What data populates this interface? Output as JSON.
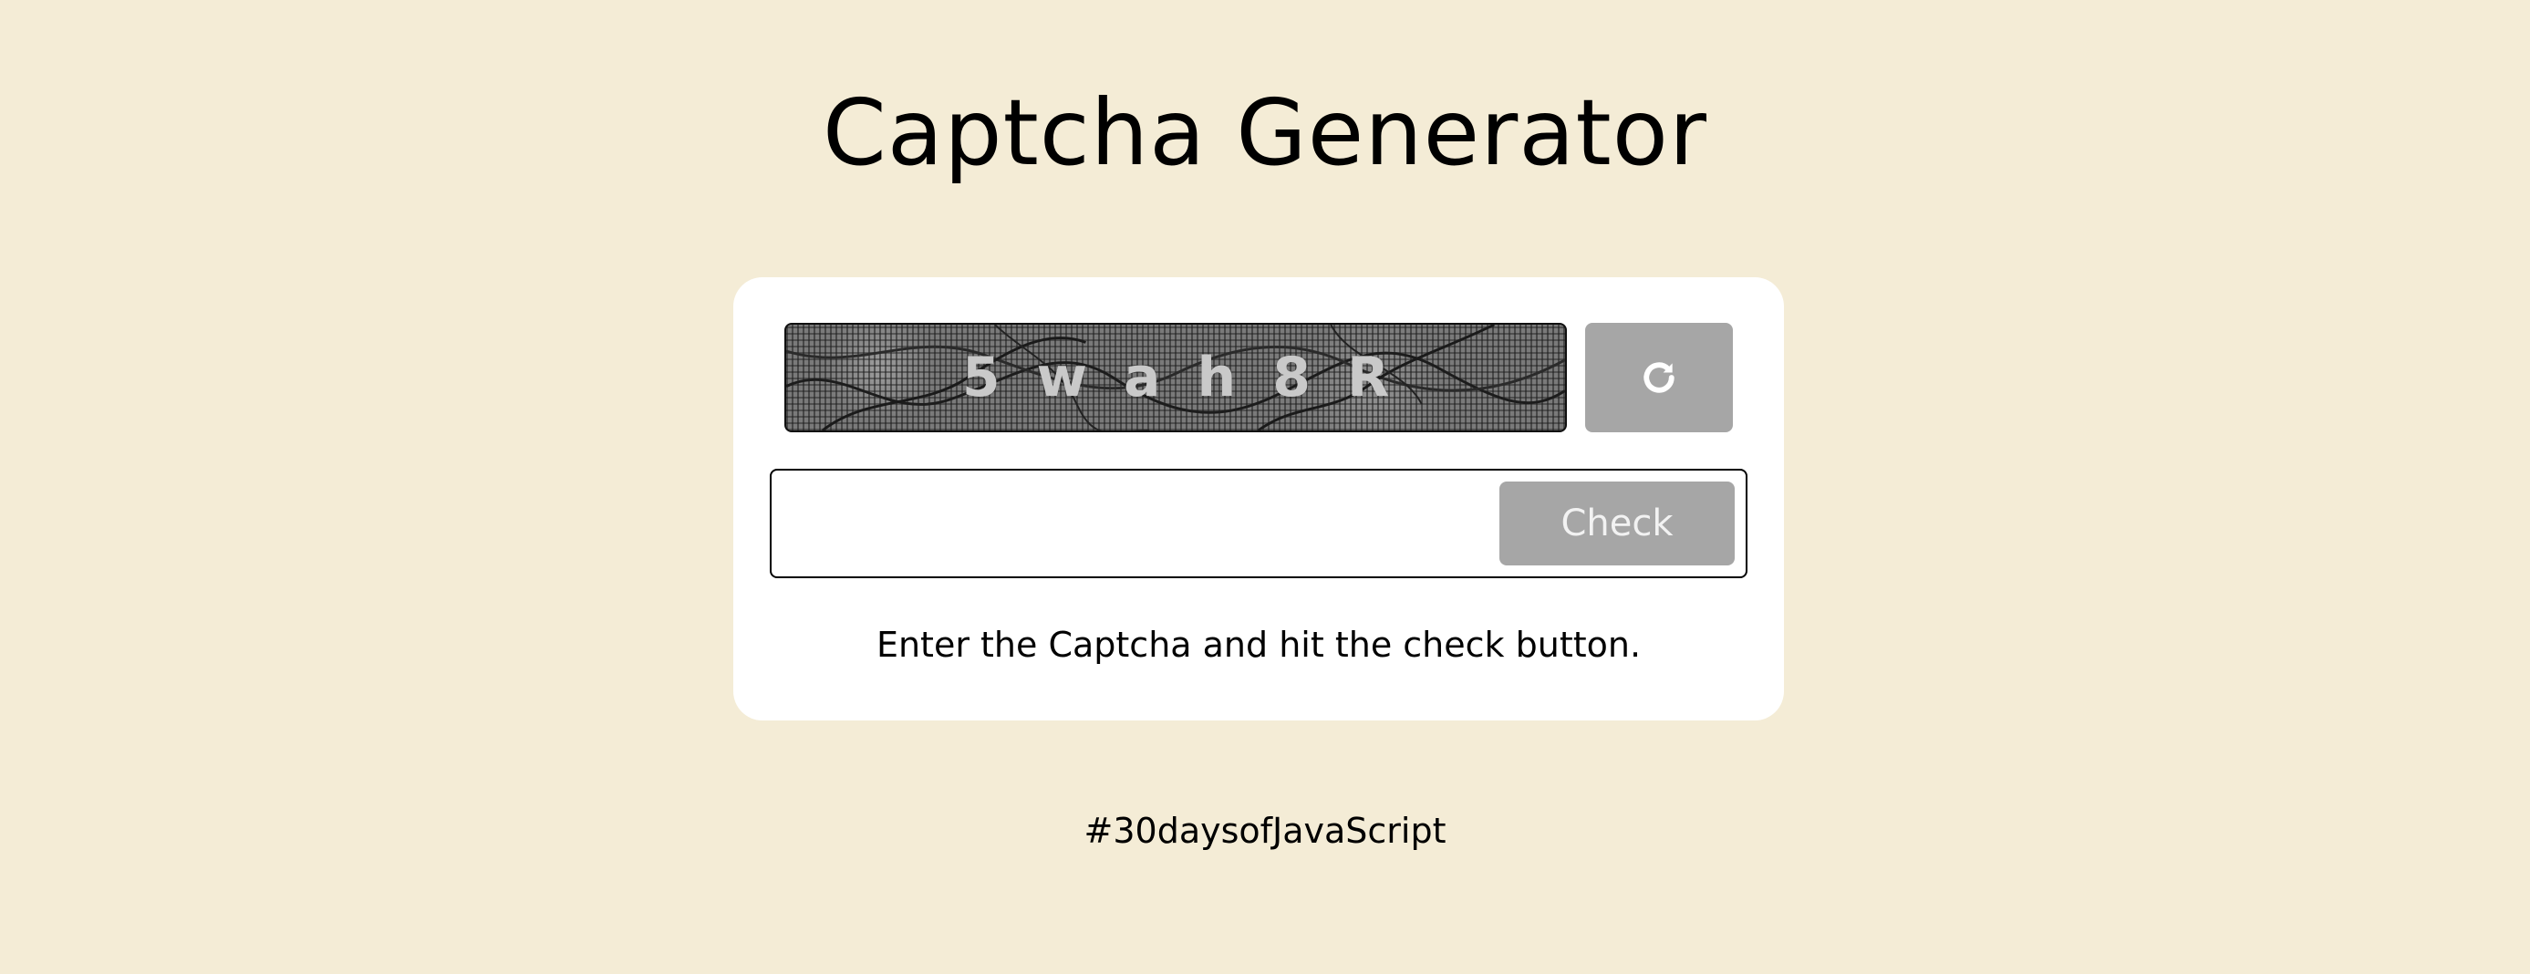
{
  "header": {
    "title": "Captcha Generator"
  },
  "captcha": {
    "text": "5wah8R",
    "refresh_icon": "refresh-icon"
  },
  "form": {
    "input_value": "",
    "input_placeholder": "",
    "check_label": "Check"
  },
  "status": {
    "message": "Enter the Captcha and hit the check button."
  },
  "footer": {
    "tag": "#30daysofJavaScript"
  },
  "colors": {
    "background": "#f4ecd6",
    "card": "#ffffff",
    "button_disabled": "#a6a6a6",
    "captcha_text": "#c9c9c9"
  }
}
